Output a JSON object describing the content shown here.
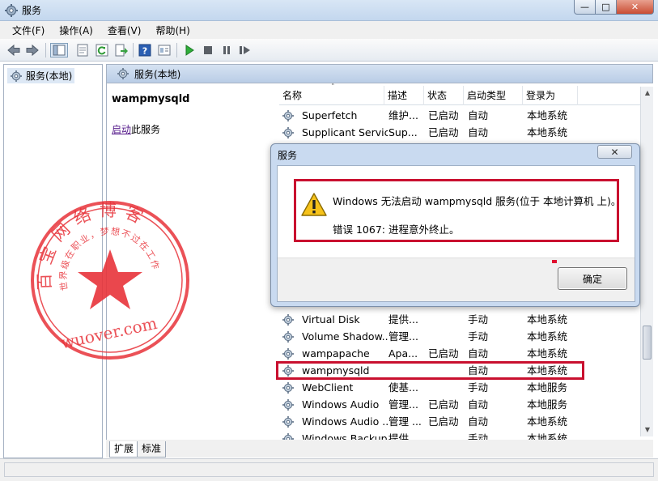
{
  "window": {
    "title": "服务",
    "controls": {
      "minimize": "—",
      "maximize": "□",
      "close": "✕"
    }
  },
  "menu": [
    "文件(F)",
    "操作(A)",
    "查看(V)",
    "帮助(H)"
  ],
  "toolbar_icons": [
    "back-arrow-icon",
    "forward-arrow-icon",
    "show-tree-icon",
    "properties-icon",
    "refresh-icon",
    "export-icon",
    "help-icon",
    "details-view-icon",
    "start-icon",
    "stop-icon",
    "pause-icon",
    "restart-icon"
  ],
  "tree": {
    "root": "服务(本地)"
  },
  "panel": {
    "header": "服务(本地)"
  },
  "detail": {
    "service_name": "wampmysqld",
    "start_link": "启动",
    "start_suffix": "此服务"
  },
  "list": {
    "columns": {
      "name": "名称",
      "desc": "描述",
      "status": "状态",
      "startup": "启动类型",
      "logon": "登录为"
    },
    "top_rows": [
      {
        "name": "Superfetch",
        "desc": "维护...",
        "status": "已启动",
        "startup": "自动",
        "logon": "本地系统"
      },
      {
        "name": "Supplicant Service",
        "desc": "Sup...",
        "status": "已启动",
        "startup": "自动",
        "logon": "本地系统"
      }
    ],
    "bottom_rows": [
      {
        "name": "Virtual Disk",
        "desc": "提供...",
        "status": "",
        "startup": "手动",
        "logon": "本地系统"
      },
      {
        "name": "Volume Shadow...",
        "desc": "管理...",
        "status": "",
        "startup": "手动",
        "logon": "本地系统"
      },
      {
        "name": "wampapache",
        "desc": "Apa...",
        "status": "已启动",
        "startup": "自动",
        "logon": "本地系统"
      },
      {
        "name": "wampmysqld",
        "desc": "",
        "status": "",
        "startup": "自动",
        "logon": "本地系统"
      },
      {
        "name": "WebClient",
        "desc": "使基...",
        "status": "",
        "startup": "手动",
        "logon": "本地服务"
      },
      {
        "name": "Windows Audio",
        "desc": "管理...",
        "status": "已启动",
        "startup": "自动",
        "logon": "本地服务"
      },
      {
        "name": "Windows Audio ...",
        "desc": "管理 ...",
        "status": "已启动",
        "startup": "自动",
        "logon": "本地系统"
      },
      {
        "name": "Windows Backup",
        "desc": "提供...",
        "status": "",
        "startup": "手动",
        "logon": "本地系统"
      }
    ]
  },
  "tabs": [
    "扩展",
    "标准"
  ],
  "dialog": {
    "title": "服务",
    "message": "Windows 无法启动 wampmysqld 服务(位于 本地计算机 上)。",
    "error": "错误 1067: 进程意外终止。",
    "ok_label": "确定",
    "close_glyph": "✕"
  },
  "watermark": {
    "top_text": "百宝网络博客",
    "inner_text": "世界级在职业，梦想不过在工作",
    "url": "wuover.com",
    "color": "#e8333a"
  }
}
